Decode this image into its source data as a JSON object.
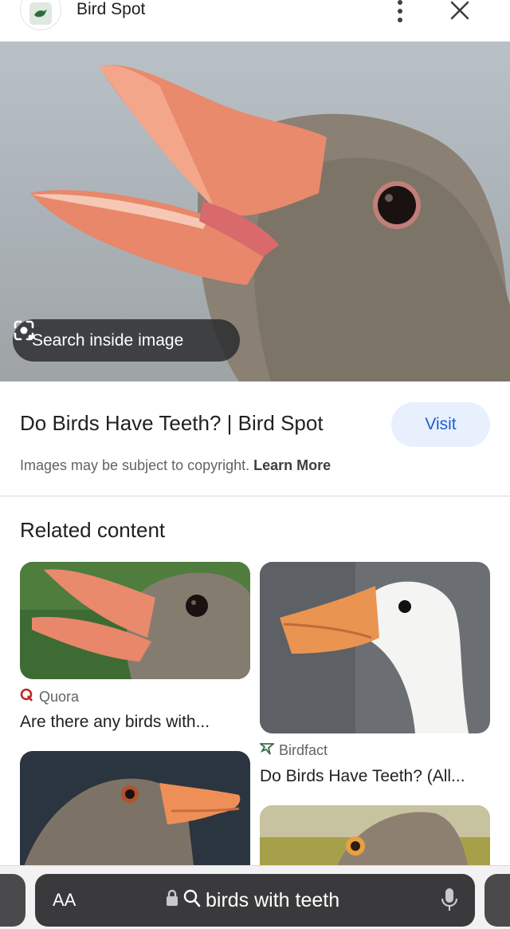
{
  "header": {
    "site_name": "Bird Spot",
    "logo_icon": "bird-spot-logo-icon",
    "more_icon": "more-vert-icon",
    "close_icon": "close-icon"
  },
  "hero": {
    "lens_label": "Search inside image",
    "lens_icon": "google-lens-icon"
  },
  "result": {
    "title": "Do Birds Have Teeth? | Bird Spot",
    "visit_label": "Visit",
    "copyright_text": "Images may be subject to copyright.",
    "learn_more": "Learn More"
  },
  "related": {
    "heading": "Related content",
    "items": [
      {
        "source": "Quora",
        "source_icon": "quora-icon",
        "title": "Are there any birds with..."
      },
      {
        "source": "Birdfact",
        "source_icon": "birdfact-icon",
        "title": "Do Birds Have Teeth? (All..."
      }
    ]
  },
  "browser": {
    "aa_label": "AA",
    "url_text": "birds with teeth",
    "lock_icon": "lock-icon",
    "search_icon": "search-icon",
    "mic_icon": "microphone-icon"
  },
  "colors": {
    "accent": "#1a5fd0",
    "visit_bg": "#e8f0fe",
    "quora_red": "#b92b27"
  }
}
